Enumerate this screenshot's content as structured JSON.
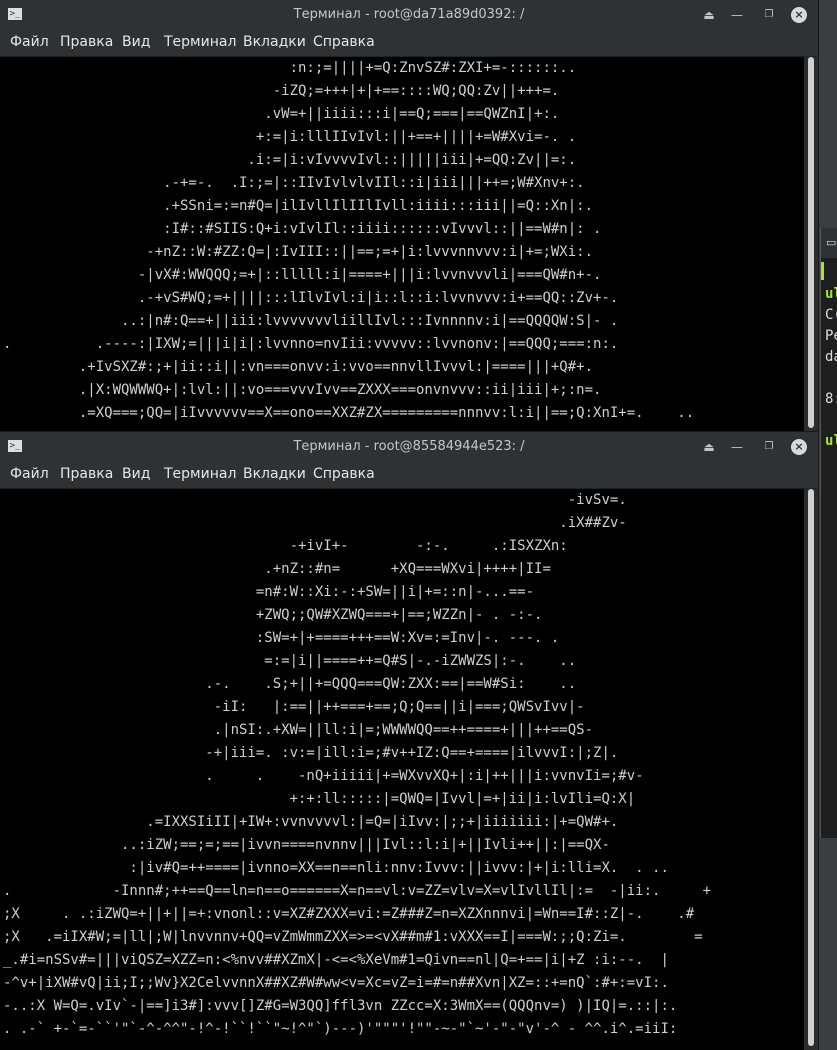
{
  "background_window": {
    "lines": [
      "ul",
      "C(",
      "Pe",
      "da",
      "",
      "8:",
      "",
      "ul"
    ]
  },
  "windows": [
    {
      "title": "Терминал - root@da71a89d0392: /",
      "menu": [
        "Файл",
        "Правка",
        "Вид",
        "Терминал",
        "Вкладки",
        "Справка"
      ],
      "terminal_text": "                                  :n:;=||||+=Q:ZnvSZ#:ZXI+=-::::::..\n                                -iZQ;=+++|+|+==::::WQ;QQ:Zv||+++=.\n                               .vW=+||iiii:::i|==Q;===|==QWZnI|+:.\n                              +:=|i:lllIIvIvl:||+==+||||+=W#Xvi=-. .\n                             .i:=|i:vIvvvvIvl::|||||iii|+=QQ:Zv||=:.\n                   .-+=-.  .I:;=|::IIvIvlvlvIIl::i|iii|||++=;W#Xnv+:.\n                   .+SSni=:=n#Q=|ilIvllIlIIlIvll:iiii:::iii||=Q::Xn|:.\n                   :I#::#SIIS:Q+i:vIvlIl::iiii::::::vIvvvl::||==W#n|: .\n                 -+nZ::W:#ZZ:Q=|:IvIII::||==;=+|i:lvvvnnvvv:i|+=;WXi:.\n                -|vX#:WWQQQ;=+|::lllll:i|====+|||i:lvvnvvvli|===QW#n+-.\n                .-+vS#WQ;=+||||:::lIlvIvl:i|i::l::i:lvvnvvv:i+==QQ::Zv+-.\n              ..:|n#:Q==+||iii:lvvvvvvvliillIvl:::Ivnnnnv:i|==QQQQW:S|- .\n.          .----:|IXW;=|||i|i|:lvvnno=nvIii:vvvvv::lvvnonv:|==QQQ;===:n:.\n         .+IvSXZ#:;+|ii::i||:vn===onvv:i:vvo==nnvllIvvvl:|====|||+Q#+.\n         .|X:WQWWWQ+|:lvl:||:vo===vvvIvv==ZXXX===onvnvvv::ii|iii|+;:n=.\n         .=XQ===;QQ=|iIvvvvvv==X==ono==XXZ#ZX=========nnnvv:l:i||==;Q:XnI+=.    .."
    },
    {
      "title": "Терминал - root@85584944e523: /",
      "menu": [
        "Файл",
        "Правка",
        "Вид",
        "Терминал",
        "Вкладки",
        "Справка"
      ],
      "terminal_text": "                                                                   -ivSv=.\n                                                                  .iX##Zv-\n                                  -+ivI+-        -:-.     .:ISXZXn:\n                               .+nZ::#n=      +XQ===WXvi|++++|II=\n                              =n#:W::Xi:-:+SW=||i|+=::n|-...==-\n                              +ZWQ;;QW#XZWQ===+|==;WZZn|- . -:-.\n                              :SW=+|+====+++==W:Xv=:=Inv|-. ---. .\n                               =:=|i||====++=Q#S|-.-iZWWZS|:-.    ..\n                        .-.    .S;+||+=QQQ===QW:ZXX:==|==W#Si:    ..\n                         -iI:   |:==||++===+==;Q;Q==||i|===;QWSvIvv|-\n                         .|nSI:.+XW=||ll:i|=;WWWWQQ==++====+|||++==QS-\n                        -+|iii=. :v:=|ill:i=;#v++IZ:Q==+====|ilvvvI:|;Z|.\n                        .     .    -nQ+iiiii|+=WXvvXQ+|:i|++|||i:vvnvIi=;#v-\n                                  +:+:ll:::::|=QWQ=|Ivvl|=+|ii|i:lvIli=Q:X|\n                 .=IXXSIiII|+IW+:vvnvvvvl:|=Q=|iIvv:|;;+|iiiiiii:|+=QW#+.\n              ..:iZW;==;=;==|ivvn====nvnnv|||Ivl::l:i|+||Ivli++||:|==QX-\n               :|iv#Q=++====|ivnno=XX==n==nli:nnv:Ivvv:||ivvv:|+|i:lli=X.  . ..\n.            -Innn#;++==Q==ln=n==o======X=n==vl:v=ZZ=vlv=X=vlIvllIl|:=  -|ii:.     +\n;X     . .:iZWQ=+||+||=+:vnonl::v=XZ#ZXXX=vi:=Z###Z=n=XZXnnnvi|=Wn==I#::Z|-.    .#\n;X   .=iIX#W;=|ll|;W|lnvvnnv+QQ=vZmWmmZXX=>=<vX##m#1:vXXX==I|===W:;;Q:Zi=.        =\n_.#i=nSSv#=|||viQSZ=XZZ=n:<%nvv##XZmX|-<=<%XeVm#1=Qivn==nl|Q=+==|i|+Z :i:--.  |\n-^v+|iXW#vQ|ii;I;;Wv}X2CelvvnnX##XZ#W#ww<v=Xc=vZ=i=#=n##Xvn|XZ=::+=nQ`:#+:=vI:.\n-..:X W=Q=.vIv`-|==]i3#]:vvv[]Z#G=W3QQ]ffl3vn ZZcc=X:3WmX==(QQQnv=) )|IQ|=.::|:.\n. .-` +-`=-``'\"`-^-^^\"-!^-!``!``\"~!^\"`)---)'\"\"\"'!\"\"-~-\"`~'-\"-\"v'-^ - ^^.i^.=iiI:"
    }
  ]
}
